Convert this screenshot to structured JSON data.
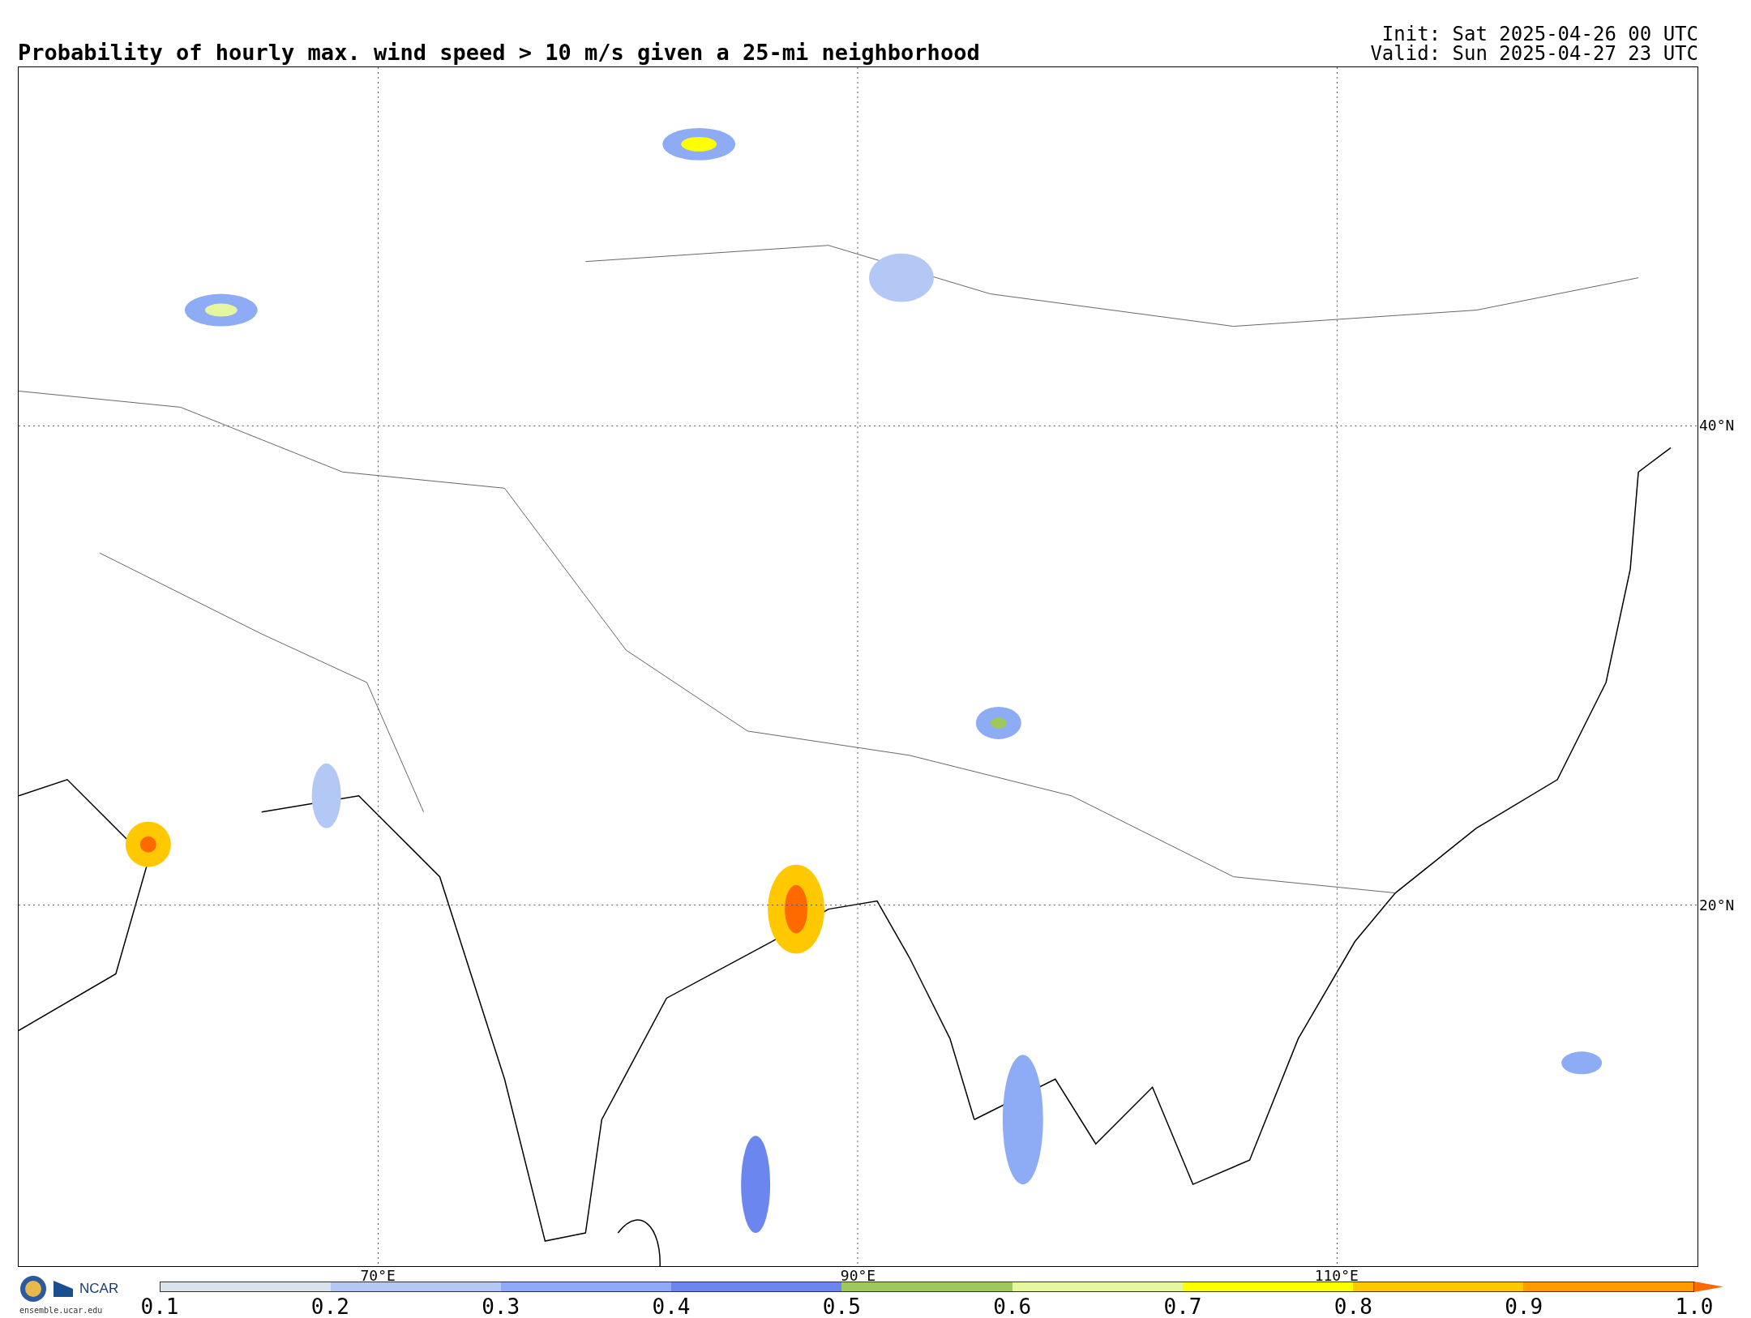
{
  "title": "Probability of hourly max. wind speed > 10 m/s given a 25-mi neighborhood",
  "init": "Init: Sat 2025-04-26 00 UTC",
  "valid": "Valid: Sun 2025-04-27 23 UTC",
  "map": {
    "lon_labels": [
      "70°E",
      "90°E",
      "110°E"
    ],
    "lat_labels": [
      "40°N",
      "20°N"
    ]
  },
  "logo": {
    "name": "NCAR",
    "url": "ensemble.ucar.edu"
  },
  "colorbar": {
    "segments": [
      {
        "color": "#d9e3ee"
      },
      {
        "color": "#b4c8f6"
      },
      {
        "color": "#8eabf6"
      },
      {
        "color": "#6b86ef"
      },
      {
        "color": "#9ec85c"
      },
      {
        "color": "#e4f6a0"
      },
      {
        "color": "#ffff00"
      },
      {
        "color": "#ffc800"
      },
      {
        "color": "#ff9a00"
      }
    ],
    "extend_arrow": {
      "color": "#ff6a00"
    },
    "ticks": [
      "0.1",
      "0.2",
      "0.3",
      "0.4",
      "0.5",
      "0.6",
      "0.7",
      "0.8",
      "0.9",
      "1.0"
    ]
  }
}
